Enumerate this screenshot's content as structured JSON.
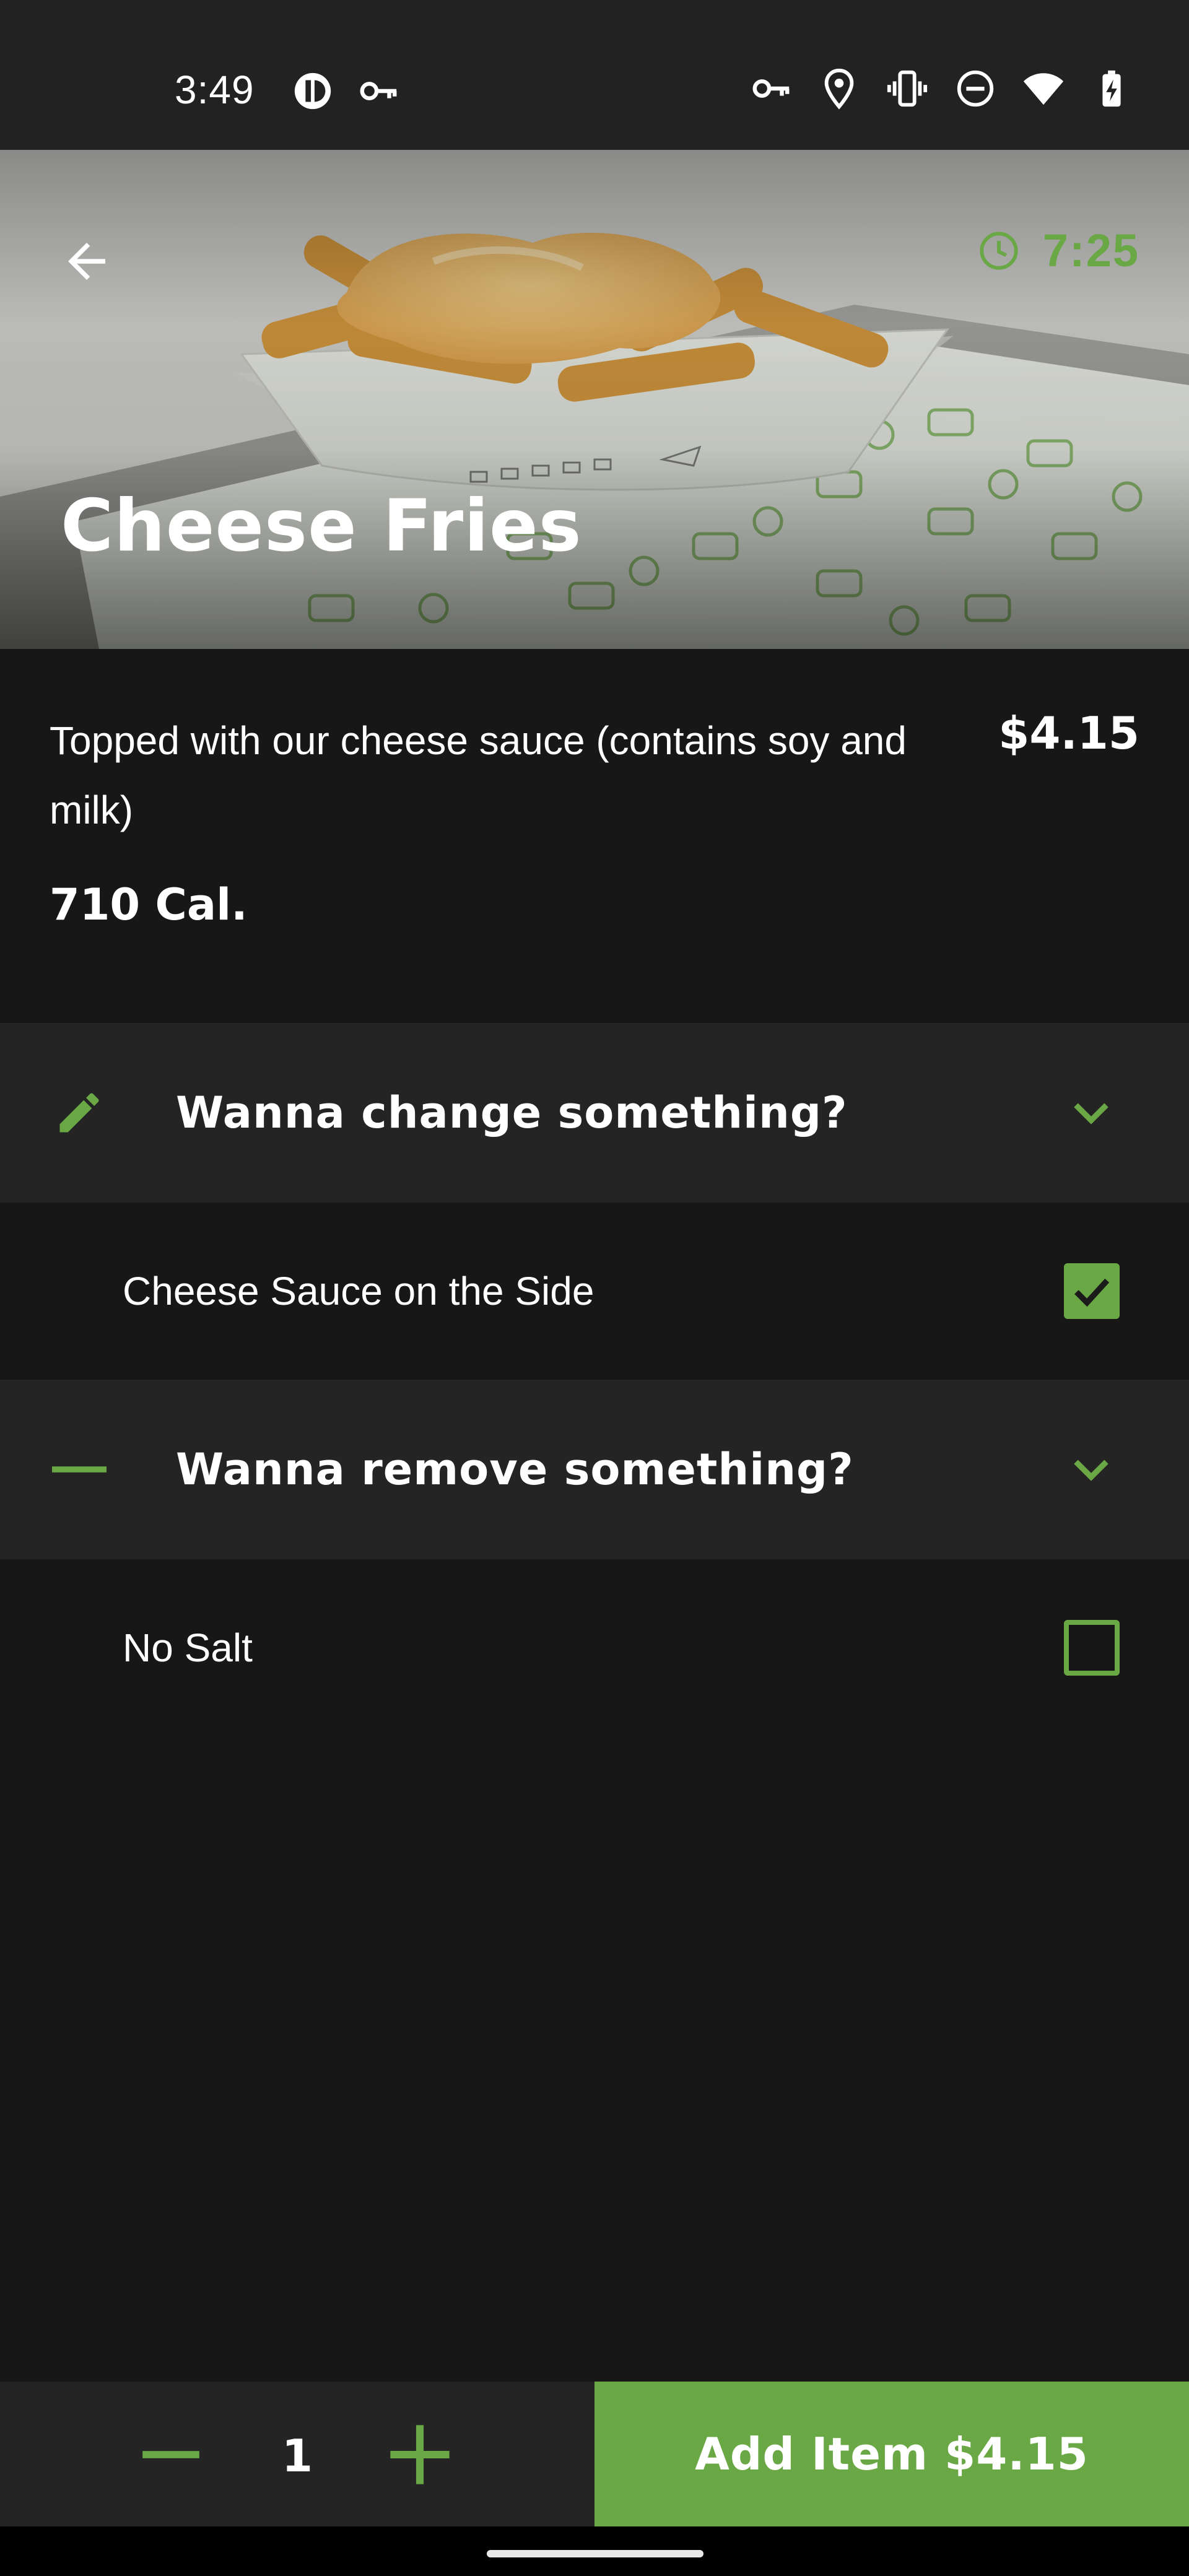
{
  "status_bar": {
    "time": "3:49",
    "left_icons": [
      "app-notification-icon",
      "vpn-key-icon"
    ],
    "right_icons": [
      "vpn-key-icon",
      "location-icon",
      "vibrate-icon",
      "do-not-disturb-icon",
      "wifi-icon",
      "battery-charging-icon"
    ]
  },
  "hero": {
    "title": "Cheese Fries",
    "timer": "7:25",
    "back_icon": "arrow-back-icon",
    "timer_icon": "clock-icon"
  },
  "item": {
    "description": "Topped with our cheese sauce (contains soy and milk)",
    "price": "$4.15",
    "calories": "710 Cal."
  },
  "sections": [
    {
      "title": "Wanna change something?",
      "icon": "pencil-icon",
      "options": [
        {
          "label": "Cheese Sauce on the Side",
          "checked": true
        }
      ]
    },
    {
      "title": "Wanna remove something?",
      "icon": "minus-icon",
      "options": [
        {
          "label": "No Salt",
          "checked": false
        }
      ]
    }
  ],
  "bottom_bar": {
    "quantity": "1",
    "add_label": "Add Item $4.15"
  },
  "colors": {
    "accent": "#6aa745",
    "background": "#171717",
    "section_bg": "#242424",
    "status_bar_bg": "#222222"
  }
}
